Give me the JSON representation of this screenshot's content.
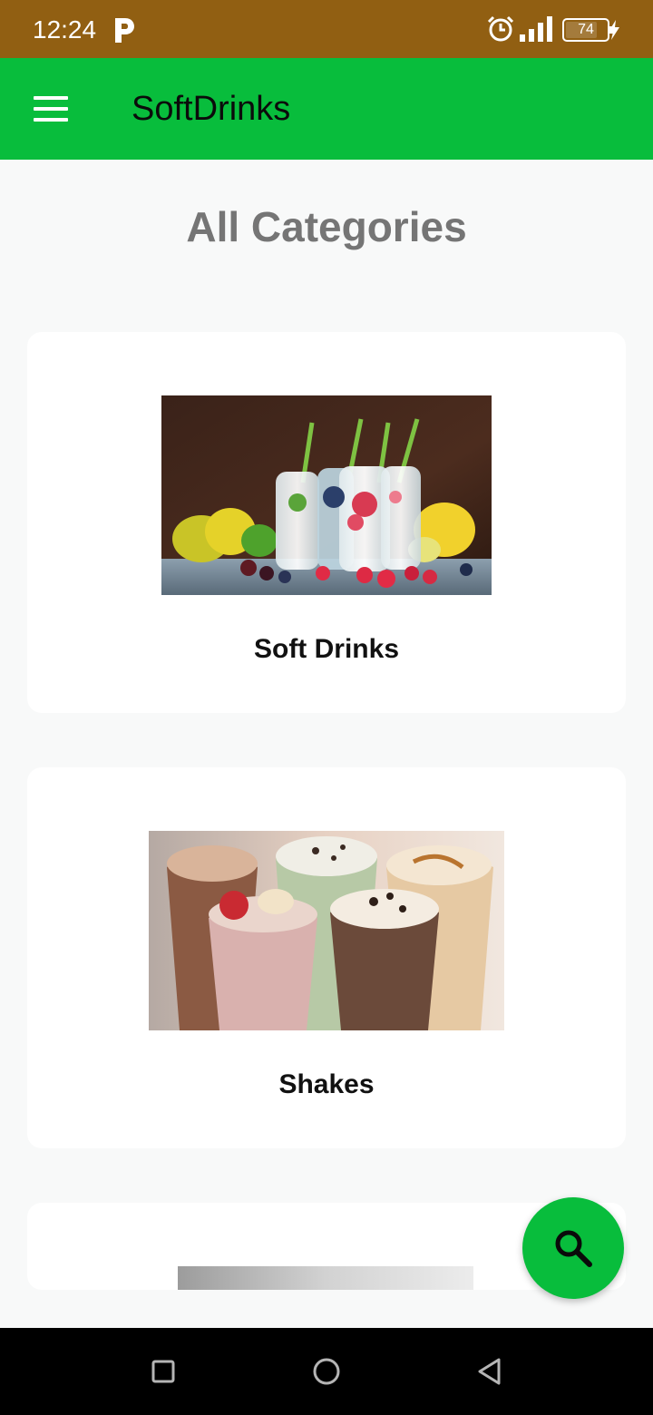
{
  "status_bar": {
    "time": "12:24",
    "battery_percent": "74",
    "icons": [
      "parking-p-icon",
      "alarm-icon",
      "signal-icon",
      "battery-icon",
      "charging-bolt-icon"
    ],
    "background": "#915f12"
  },
  "app_bar": {
    "title": "SoftDrinks",
    "menu_icon": "hamburger-menu-icon",
    "background": "#08bd3c"
  },
  "page": {
    "title": "All Categories"
  },
  "categories": [
    {
      "label": "Soft Drinks",
      "image": "bottles-with-fruit-photo"
    },
    {
      "label": "Shakes",
      "image": "milkshake-glasses-photo"
    },
    {
      "label": "",
      "image": "partial-photo"
    }
  ],
  "fab": {
    "icon": "search-icon",
    "background": "#08bd3c"
  },
  "nav_bar": {
    "buttons": [
      "recents-square-icon",
      "home-circle-icon",
      "back-triangle-icon"
    ]
  }
}
